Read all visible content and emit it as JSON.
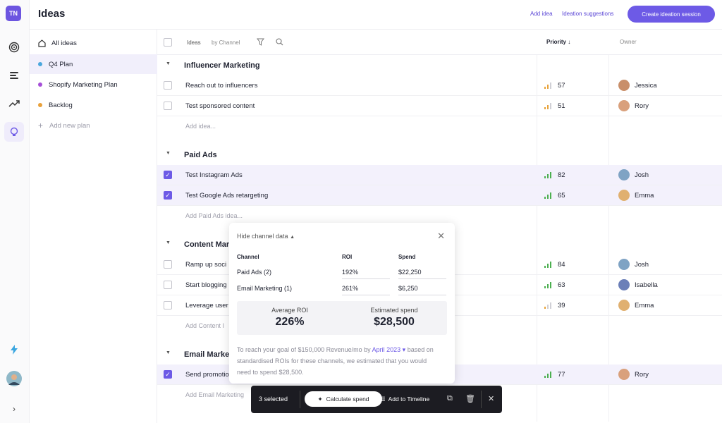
{
  "app": {
    "workspace_initials": "TN",
    "page_title": "Ideas"
  },
  "topbar": {
    "add_idea": "Add idea",
    "ideation_suggestions": "Ideation suggestions",
    "create_session": "Create ideation session"
  },
  "plans": {
    "all_ideas": "All ideas",
    "items": [
      {
        "label": "Q4 Plan",
        "color": "#4ba7dd",
        "selected": true
      },
      {
        "label": "Shopify Marketing Plan",
        "color": "#a64fd8",
        "selected": false
      },
      {
        "label": "Backlog",
        "color": "#e9a13b",
        "selected": false
      }
    ],
    "add_new": "Add new plan"
  },
  "table": {
    "tabs": [
      "Ideas",
      "by Channel"
    ],
    "col_priority": "Priority ↓",
    "col_owner": "Owner",
    "sections": [
      {
        "name": "Influencer Marketing",
        "add_label": "Add idea...",
        "rows": [
          {
            "text": "Reach out to influencers",
            "priority": "57",
            "owner": "Jessica",
            "checked": false
          },
          {
            "text": "Test sponsored content",
            "priority": "51",
            "owner": "Rory",
            "checked": false
          }
        ]
      },
      {
        "name": "Paid Ads",
        "add_label": "Add Paid Ads idea...",
        "rows": [
          {
            "text": "Test Instagram Ads",
            "priority": "82",
            "owner": "Josh",
            "checked": true
          },
          {
            "text": "Test Google Ads retargeting",
            "priority": "65",
            "owner": "Emma",
            "checked": true
          }
        ]
      },
      {
        "name": "Content Mar",
        "add_label": "Add Content I",
        "rows": [
          {
            "text": "Ramp up soci",
            "priority": "84",
            "owner": "Josh",
            "checked": false
          },
          {
            "text": "Start blogging",
            "priority": "63",
            "owner": "Isabella",
            "checked": false
          },
          {
            "text": "Leverage user",
            "priority": "39",
            "owner": "Emma",
            "checked": false
          }
        ]
      },
      {
        "name": "Email Marke",
        "add_label": "Add Email Marketing",
        "rows": [
          {
            "text": "Send promotio",
            "priority": "77",
            "owner": "Rory",
            "checked": true
          }
        ]
      }
    ]
  },
  "popup": {
    "header": "Hide channel data",
    "cols": [
      "Channel",
      "ROI",
      "Spend"
    ],
    "rows": [
      {
        "channel": "Paid Ads (2)",
        "roi": "192%",
        "spend": "$22,250"
      },
      {
        "channel": "Email Marketing (1)",
        "roi": "261%",
        "spend": "$6,250"
      }
    ],
    "avg_roi_label": "Average ROI",
    "avg_roi": "226%",
    "est_spend_label": "Estimated spend",
    "est_spend": "$28,500",
    "note_a": "To reach your goal of $150,000 Revenue/mo by ",
    "note_month": "April 2023",
    "note_b": "based on standardised ROIs for these channels, we estimated that you would need to spend $28,500."
  },
  "actionbar": {
    "selected": "3 selected",
    "calculate": "Calculate spend",
    "timeline": "Add to Timeline"
  }
}
